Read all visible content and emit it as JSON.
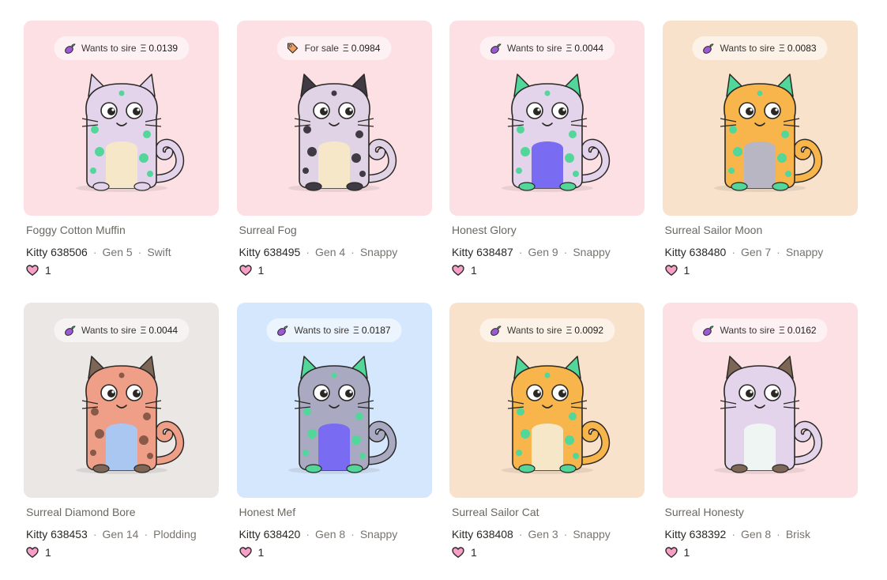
{
  "kitties": [
    {
      "name": "Foggy Cotton Muffin",
      "id": "Kitty 638506",
      "gen": "Gen 5",
      "speed": "Swift",
      "likes": "1",
      "badge": {
        "icon": "eggplant-icon",
        "label": "Wants to sire",
        "currency": "Ξ",
        "price": "0.0139"
      },
      "bg": "#fde0e4",
      "body": "#e3d4ec",
      "spots": "#52d69a",
      "belly": "#f5e7c8",
      "ears": "#e3d4ec"
    },
    {
      "name": "Surreal Fog",
      "id": "Kitty 638495",
      "gen": "Gen 4",
      "speed": "Snappy",
      "likes": "1",
      "badge": {
        "icon": "price-tag-icon",
        "label": "For sale",
        "currency": "Ξ",
        "price": "0.0984"
      },
      "bg": "#fde0e4",
      "body": "#e0d3e6",
      "spots": "#3f3a44",
      "belly": "#f5e7c8",
      "ears": "#3f3a44"
    },
    {
      "name": "Honest Glory",
      "id": "Kitty 638487",
      "gen": "Gen 9",
      "speed": "Snappy",
      "likes": "1",
      "badge": {
        "icon": "eggplant-icon",
        "label": "Wants to sire",
        "currency": "Ξ",
        "price": "0.0044"
      },
      "bg": "#fde0e4",
      "body": "#e3d4ec",
      "spots": "#52d69a",
      "belly": "#7a6cf2",
      "ears": "#52d69a"
    },
    {
      "name": "Surreal Sailor Moon",
      "id": "Kitty 638480",
      "gen": "Gen 7",
      "speed": "Snappy",
      "likes": "1",
      "badge": {
        "icon": "eggplant-icon",
        "label": "Wants to sire",
        "currency": "Ξ",
        "price": "0.0083"
      },
      "bg": "#f9e2cb",
      "body": "#f7b54c",
      "spots": "#52d69a",
      "belly": "#b9b6c4",
      "ears": "#52d69a"
    },
    {
      "name": "Surreal Diamond Bore",
      "id": "Kitty 638453",
      "gen": "Gen 14",
      "speed": "Plodding",
      "likes": "1",
      "badge": {
        "icon": "eggplant-icon",
        "label": "Wants to sire",
        "currency": "Ξ",
        "price": "0.0044"
      },
      "bg": "#ebe7e5",
      "body": "#ef9f87",
      "spots": "#8a5a48",
      "belly": "#a9c7f0",
      "ears": "#7d6656"
    },
    {
      "name": "Honest Mef",
      "id": "Kitty 638420",
      "gen": "Gen 8",
      "speed": "Snappy",
      "likes": "1",
      "badge": {
        "icon": "eggplant-icon",
        "label": "Wants to sire",
        "currency": "Ξ",
        "price": "0.0187"
      },
      "bg": "#d5e7fd",
      "body": "#a9aac2",
      "spots": "#52d69a",
      "belly": "#7a6cf2",
      "ears": "#52d69a"
    },
    {
      "name": "Surreal Sailor Cat",
      "id": "Kitty 638408",
      "gen": "Gen 3",
      "speed": "Snappy",
      "likes": "1",
      "badge": {
        "icon": "eggplant-icon",
        "label": "Wants to sire",
        "currency": "Ξ",
        "price": "0.0092"
      },
      "bg": "#f9e2cb",
      "body": "#f7b54c",
      "spots": "#52d69a",
      "belly": "#f5e7c8",
      "ears": "#52d69a"
    },
    {
      "name": "Surreal Honesty",
      "id": "Kitty 638392",
      "gen": "Gen 8",
      "speed": "Brisk",
      "likes": "1",
      "badge": {
        "icon": "eggplant-icon",
        "label": "Wants to sire",
        "currency": "Ξ",
        "price": "0.0162"
      },
      "bg": "#fde0e4",
      "body": "#e3d4ec",
      "spots": "#e3d4ec",
      "belly": "#eef5f3",
      "ears": "#7d6656"
    }
  ]
}
